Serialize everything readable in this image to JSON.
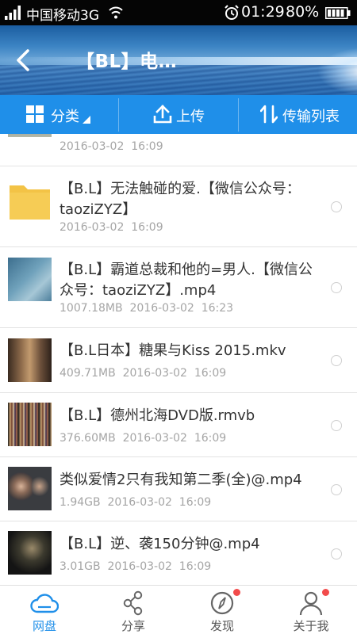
{
  "status_bar": {
    "carrier": "中国移动3G",
    "time": "01:29",
    "battery": "80%"
  },
  "header": {
    "title": "【BL】电…",
    "back_icon": "chevron-left-icon"
  },
  "toolbar": {
    "category_label": "分类",
    "upload_label": "上传",
    "transfer_label": "传输列表"
  },
  "files": [
    {
      "name": "",
      "meta": "2016-03-02  16:09"
    },
    {
      "name": "【B.L】无法触碰的爱.【微信公众号：taoziZYZ】",
      "meta": "2016-03-02  16:09",
      "type": "folder"
    },
    {
      "name": "【B.L】霸道总裁和他的=男人.【微信公众号：taoziZYZ】.mp4",
      "meta": "1007.18MB  2016-03-02  16:23",
      "type": "video"
    },
    {
      "name": "【B.L日本】糖果与Kiss  2015.mkv",
      "meta": "409.71MB  2016-03-02  16:09",
      "type": "video"
    },
    {
      "name": "【B.L】德州北海DVD版.rmvb",
      "meta": "376.60MB  2016-03-02  16:09",
      "type": "video"
    },
    {
      "name": "类似爱情2只有我知第二季(全)@.mp4",
      "meta": "1.94GB  2016-03-02  16:09",
      "type": "video"
    },
    {
      "name": "【B.L】逆、袭150分钟@.mp4",
      "meta": "3.01GB  2016-03-02  16:09",
      "type": "video"
    }
  ],
  "bottom_nav": {
    "items": [
      {
        "label": "网盘",
        "icon": "cloud-icon",
        "active": true
      },
      {
        "label": "分享",
        "icon": "share-icon"
      },
      {
        "label": "发现",
        "icon": "compass-icon"
      },
      {
        "label": "关于我",
        "icon": "person-icon"
      }
    ]
  },
  "colors": {
    "accent": "#1f8fe9",
    "badge": "#f24b4b"
  }
}
